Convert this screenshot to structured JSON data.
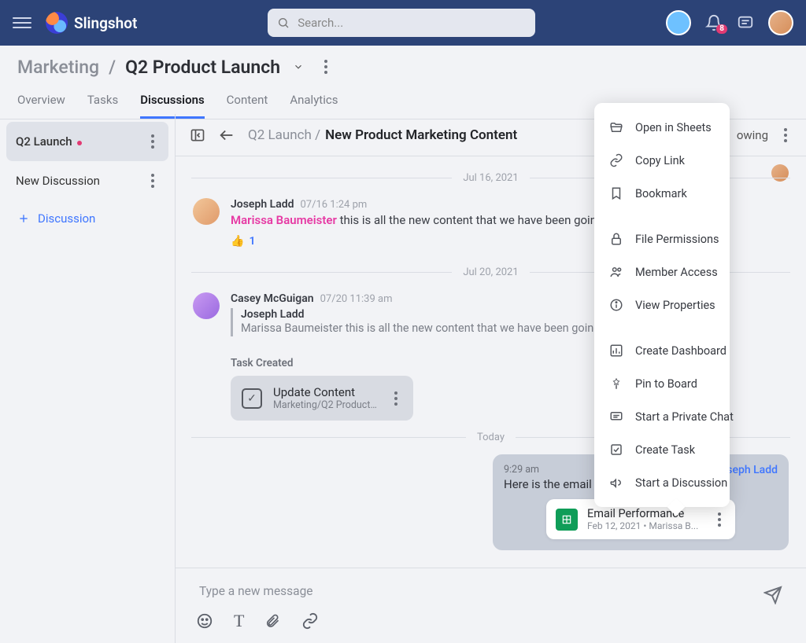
{
  "app": {
    "name": "Slingshot"
  },
  "search": {
    "placeholder": "Search..."
  },
  "notifications": {
    "count": "8"
  },
  "breadcrumb": {
    "parent": "Marketing",
    "current": "Q2 Product Launch"
  },
  "tabs": [
    "Overview",
    "Tasks",
    "Discussions",
    "Content",
    "Analytics"
  ],
  "active_tab": "Discussions",
  "sidebar": {
    "items": [
      {
        "label": "Q2 Launch",
        "unread": true
      },
      {
        "label": "New Discussion"
      }
    ],
    "add_label": "Discussion"
  },
  "thread": {
    "path": "Q2 Launch /",
    "title": "New Product Marketing Content",
    "follow_label": "owing"
  },
  "messages": {
    "d1": "Jul 16, 2021",
    "m1": {
      "author": "Joseph Ladd",
      "meta": "07/16 1:24 pm",
      "mention": "Marissa Baumeister",
      "text": " this is all the new content that we have been going back a",
      "react_count": "1"
    },
    "d2": "Jul 20, 2021",
    "m2": {
      "author": "Casey McGuigan",
      "meta": "07/20 11:39 am",
      "quote_author": "Joseph Ladd",
      "quote_text": "Marissa Baumeister this is all the new content that we have been going back"
    },
    "task": {
      "section": "Task Created",
      "title": "Update Content",
      "sub": "Marketing/Q2 Product L..."
    },
    "d3": "Today",
    "own": {
      "time": "9:29 am",
      "text": "Here is the email data",
      "right": "seph Ladd"
    },
    "file": {
      "title": "Email Performance",
      "sub": "Feb 12, 2021 • Marissa B..."
    }
  },
  "composer": {
    "placeholder": "Type a new message"
  },
  "context_menu": {
    "open_sheets": "Open in Sheets",
    "copy_link": "Copy Link",
    "bookmark": "Bookmark",
    "file_perm": "File Permissions",
    "member_access": "Member Access",
    "view_props": "View Properties",
    "create_dash": "Create Dashboard",
    "pin_board": "Pin to Board",
    "private_chat": "Start a Private Chat",
    "create_task": "Create Task",
    "start_disc": "Start a Discussion"
  }
}
